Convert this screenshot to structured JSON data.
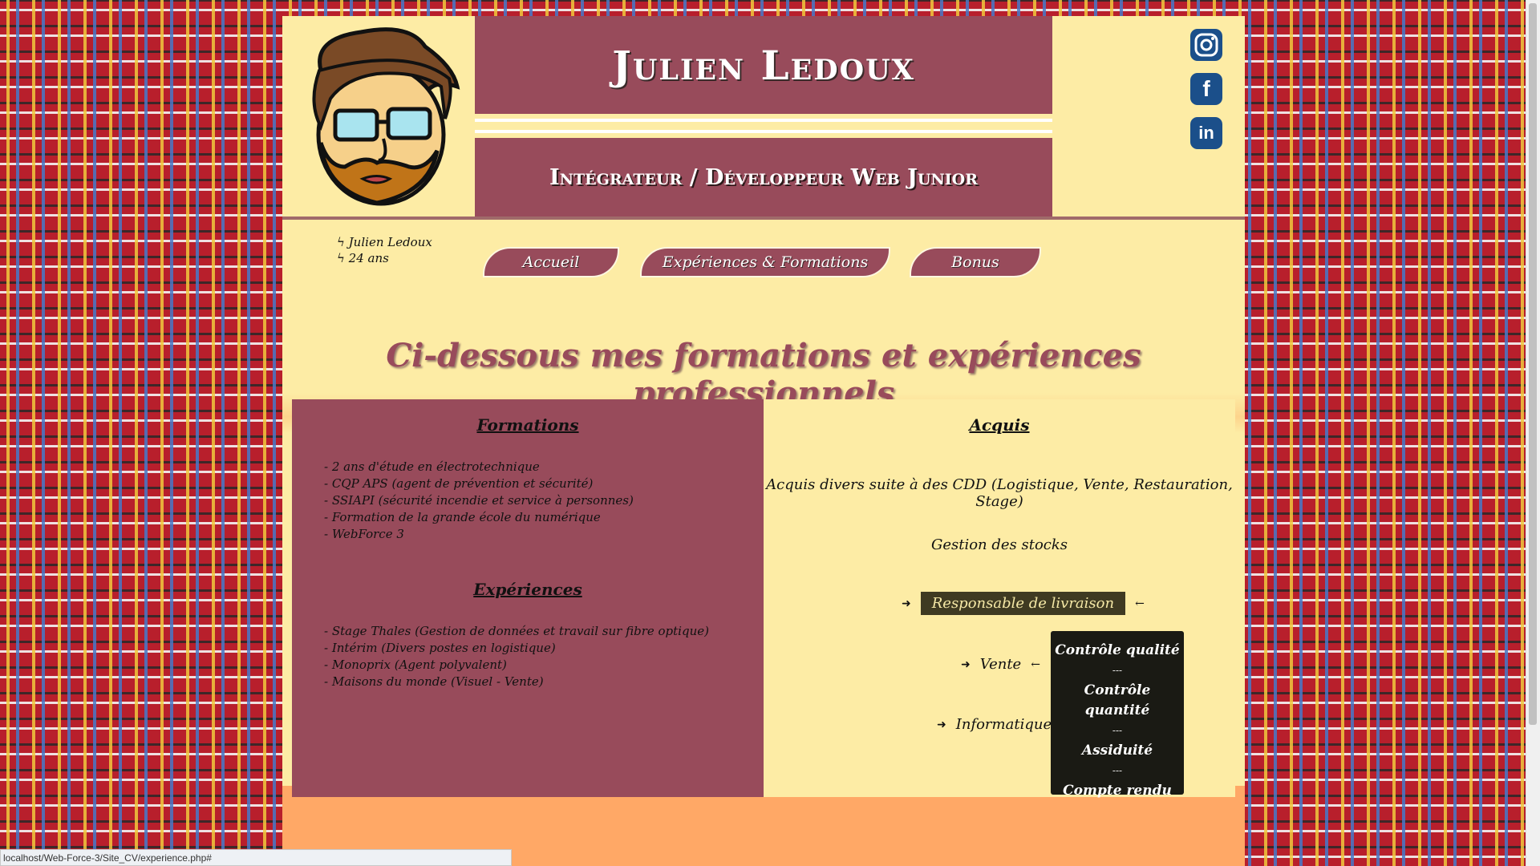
{
  "header": {
    "name": "Julien Ledoux",
    "job_title": "Intégrateur / Développeur Web Junior"
  },
  "social": [
    {
      "icon": "instagram-icon",
      "label": "instagram"
    },
    {
      "icon": "facebook-icon",
      "label": "f"
    },
    {
      "icon": "linkedin-icon",
      "label": "in"
    }
  ],
  "info": {
    "line1": "Julien Ledoux",
    "line2": "24 ans"
  },
  "nav": {
    "home": "Accueil",
    "experience": "Expériences & Formations",
    "bonus": "Bonus"
  },
  "main_heading": "Ci-dessous mes formations et expériences professionnels",
  "formations": {
    "heading": "Formations",
    "items": [
      "- 2 ans d'étude en électrotechnique",
      "- CQP APS (agent de prévention et sécurité)",
      "- SSIAPI (sécurité incendie et service à personnes)",
      "- Formation de la grande école du numérique",
      "- WebForce 3"
    ]
  },
  "experiences": {
    "heading": "Expériences",
    "items": [
      "- Stage Thales (Gestion de données et travail sur fibre optique)",
      "- Intérim (Divers postes en logistique)",
      "- Monoprix (Agent polyvalent)",
      "- Maisons du monde (Visuel - Vente)"
    ]
  },
  "acquis": {
    "heading": "Acquis",
    "summary": "Acquis divers suite à des CDD (Logistique, Vente, Restauration, Stage)",
    "stock": "Gestion des stocks",
    "delivery": "Responsable de livraison",
    "sales": "Vente",
    "it": "Informatique",
    "tooltip": {
      "items": [
        "Contrôle qualité",
        "Contrôle quantité",
        "Assiduité",
        "Compte rendu"
      ],
      "separator": "---"
    }
  },
  "status_url": "localhost/Web-Force-3/Site_CV/experience.php#",
  "colors": {
    "brand": "#984b5b",
    "background": "#fdeca5",
    "footer": "#ffa866"
  }
}
